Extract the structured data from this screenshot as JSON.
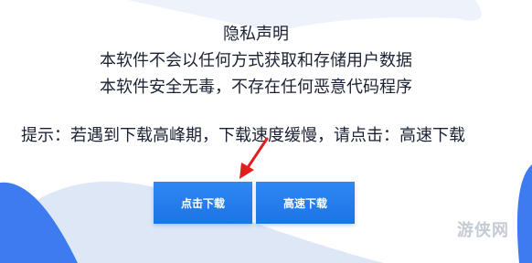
{
  "privacy": {
    "title": "隐私声明",
    "line1": "本软件不会以任何方式获取和存储用户数据",
    "line2": "本软件安全无毒，不存在任何恶意代码程序"
  },
  "tip": {
    "text": "提示：若遇到下载高峰期，下载速度缓慢，请点击：高速下载"
  },
  "buttons": {
    "click_download": "点击下载",
    "fast_download": "高速下载"
  },
  "watermark": {
    "text": "游侠网"
  },
  "colors": {
    "button": "#1c74e6",
    "background_blob": "#dde7f6",
    "accent_blob": "#3d7cf0",
    "arrow": "#e02020"
  }
}
